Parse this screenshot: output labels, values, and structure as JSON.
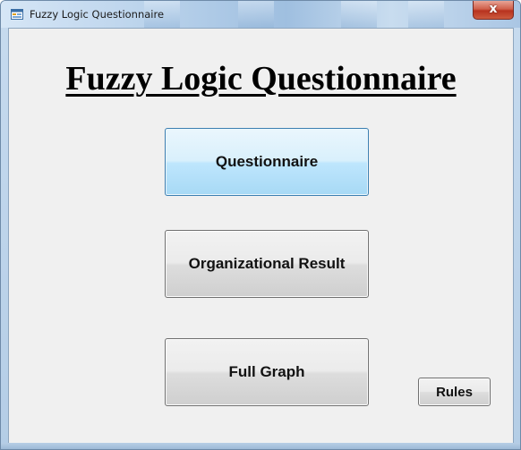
{
  "window": {
    "title": "Fuzzy Logic Questionnaire",
    "icon": "app-form-icon",
    "close_glyph": "x"
  },
  "main": {
    "heading": "Fuzzy Logic Questionnaire",
    "buttons": {
      "questionnaire": "Questionnaire",
      "organizational_result": "Organizational Result",
      "full_graph": "Full Graph",
      "rules": "Rules"
    }
  },
  "colors": {
    "form_background": "#f0f0f0",
    "focused_button_border": "#3c7fb1",
    "close_button": "#c94a33"
  }
}
